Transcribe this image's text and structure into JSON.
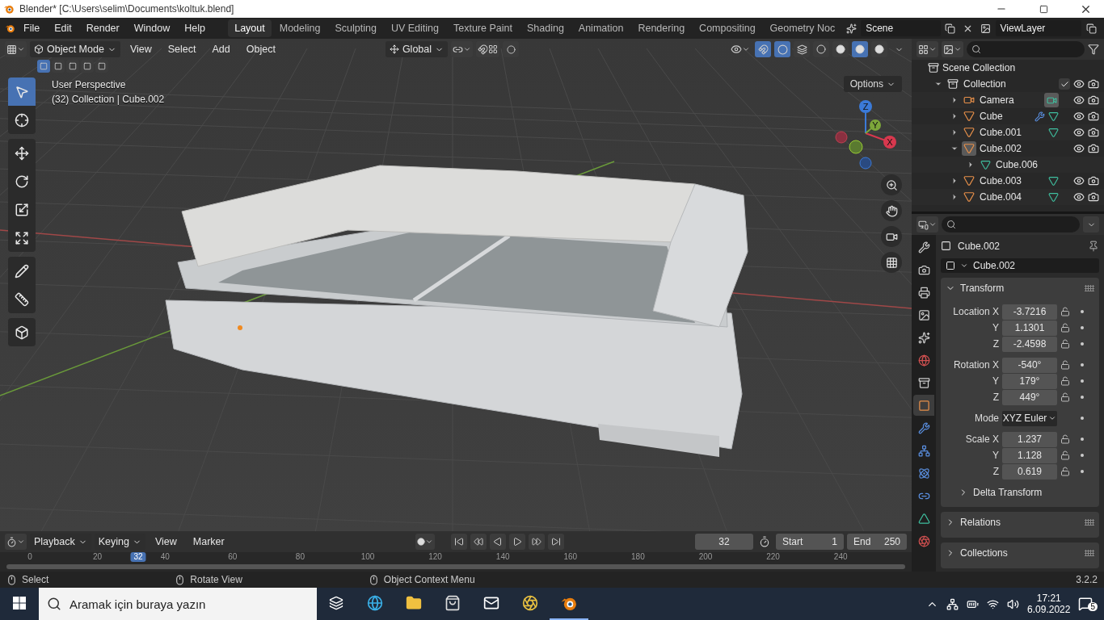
{
  "window": {
    "title": "Blender* [C:\\Users\\selim\\Documents\\koltuk.blend]"
  },
  "menu": [
    "File",
    "Edit",
    "Render",
    "Window",
    "Help"
  ],
  "workspaces": [
    {
      "label": "Layout",
      "selected": true
    },
    {
      "label": "Modeling",
      "selected": false
    },
    {
      "label": "Sculpting",
      "selected": false
    },
    {
      "label": "UV Editing",
      "selected": false
    },
    {
      "label": "Texture Paint",
      "selected": false
    },
    {
      "label": "Shading",
      "selected": false
    },
    {
      "label": "Animation",
      "selected": false
    },
    {
      "label": "Rendering",
      "selected": false
    },
    {
      "label": "Compositing",
      "selected": false
    },
    {
      "label": "Geometry Noc",
      "selected": false
    }
  ],
  "scene": "Scene",
  "view_layer": "ViewLayer",
  "viewport_header": {
    "mode": "Object Mode",
    "menus": [
      "View",
      "Select",
      "Add",
      "Object"
    ],
    "orientation": "Global",
    "options": "Options"
  },
  "viewport_toggles": [
    {
      "kind": "gizmo",
      "on": true
    },
    {
      "kind": "overlay",
      "on": true
    },
    {
      "kind": "xray",
      "on": false
    }
  ],
  "shading": [
    {
      "kind": "wireframe",
      "selected": false
    },
    {
      "kind": "solid",
      "selected": false
    },
    {
      "kind": "material",
      "selected": true
    },
    {
      "kind": "rendered",
      "selected": false
    }
  ],
  "select_modes": [
    {
      "selected": true
    },
    {
      "selected": false
    },
    {
      "selected": false
    },
    {
      "selected": false
    },
    {
      "selected": false
    }
  ],
  "toolbar": [
    {
      "kind": "select",
      "selected": true
    },
    {
      "kind": "cursor",
      "selected": false
    },
    {
      "kind": "move",
      "selected": false
    },
    {
      "kind": "rotate",
      "selected": false
    },
    {
      "kind": "scale",
      "selected": false
    },
    {
      "kind": "transform",
      "selected": false
    },
    {
      "kind": "annotate",
      "selected": false
    },
    {
      "kind": "measure",
      "selected": false
    },
    {
      "kind": "add-cube",
      "selected": false
    }
  ],
  "viewport_info": [
    "User Perspective",
    "(32) Collection | Cube.002"
  ],
  "gizmo": {
    "z": "Z",
    "y": "Y",
    "x": "X"
  },
  "outliner": {
    "root": "Scene Collection",
    "items": [
      {
        "name": "Collection",
        "kind": "collection",
        "expanded": true,
        "checked": true,
        "selected": false,
        "children": [
          {
            "name": "Camera",
            "kind": "camera",
            "expanded": false,
            "selected": false,
            "data_icons": [
              {
                "kind": "camera"
              }
            ]
          },
          {
            "name": "Cube",
            "kind": "object",
            "expanded": false,
            "selected": false,
            "data_icons": [
              {
                "kind": "wrench"
              },
              {
                "kind": "mesh"
              }
            ]
          },
          {
            "name": "Cube.001",
            "kind": "object",
            "expanded": false,
            "selected": false,
            "data_icons": [
              {
                "kind": "mesh"
              }
            ]
          },
          {
            "name": "Cube.002",
            "kind": "object",
            "expanded": true,
            "selected": true,
            "children": [
              {
                "name": "Cube.006",
                "kind": "mesh",
                "expanded": false,
                "selected": false
              }
            ]
          },
          {
            "name": "Cube.003",
            "kind": "object",
            "expanded": false,
            "selected": false,
            "data_icons": [
              {
                "kind": "mesh"
              }
            ]
          },
          {
            "name": "Cube.004",
            "kind": "object",
            "expanded": false,
            "selected": false,
            "data_icons": [
              {
                "kind": "mesh"
              }
            ]
          }
        ]
      }
    ]
  },
  "properties": {
    "tabs": [
      {
        "kind": "tool",
        "selected": false
      },
      {
        "kind": "render",
        "selected": false
      },
      {
        "kind": "output",
        "selected": false
      },
      {
        "kind": "view-layer",
        "selected": false
      },
      {
        "kind": "scene",
        "selected": false
      },
      {
        "kind": "world",
        "selected": false
      },
      {
        "kind": "collection",
        "selected": false
      },
      {
        "kind": "object",
        "selected": true
      },
      {
        "kind": "modifier",
        "selected": false
      },
      {
        "kind": "particles",
        "selected": false
      },
      {
        "kind": "physics",
        "selected": false
      },
      {
        "kind": "constraints",
        "selected": false
      },
      {
        "kind": "data",
        "selected": false
      },
      {
        "kind": "material",
        "selected": false
      }
    ],
    "object": "Cube.002",
    "name_field": "Cube.002",
    "panel": {
      "title": "Transform",
      "expanded": true,
      "groups": [
        {
          "rows": [
            {
              "label": "Location X",
              "value": "-3.7216",
              "kind": "number"
            },
            {
              "label": "Y",
              "value": "1.1301",
              "kind": "number"
            },
            {
              "label": "Z",
              "value": "-2.4598",
              "kind": "number"
            }
          ]
        },
        {
          "rows": [
            {
              "label": "Rotation X",
              "value": "-540°",
              "kind": "number"
            },
            {
              "label": "Y",
              "value": "179°",
              "kind": "number"
            },
            {
              "label": "Z",
              "value": "449°",
              "kind": "number"
            }
          ]
        },
        {
          "rows": [
            {
              "label": "Mode",
              "value": "XYZ Euler",
              "kind": "dropdown"
            }
          ]
        },
        {
          "rows": [
            {
              "label": "Scale X",
              "value": "1.237",
              "kind": "number"
            },
            {
              "label": "Y",
              "value": "1.128",
              "kind": "number"
            },
            {
              "label": "Z",
              "value": "0.619",
              "kind": "number"
            }
          ]
        }
      ],
      "subpanels": [
        {
          "title": "Delta Transform",
          "expanded": false
        }
      ]
    },
    "panels": [
      {
        "title": "Relations",
        "expanded": false
      },
      {
        "title": "Collections",
        "expanded": false
      }
    ]
  },
  "timeline": {
    "menus": [
      "Playback",
      "Keying",
      "View",
      "Marker"
    ],
    "current": "32",
    "start_label": "Start",
    "start": "1",
    "end_label": "End",
    "end": "250",
    "ruler": [
      "0",
      "20",
      "40",
      "60",
      "80",
      "100",
      "120",
      "140",
      "160",
      "180",
      "200",
      "220",
      "240"
    ],
    "playhead": "32"
  },
  "status_bar": {
    "hints": [
      "Select",
      "Rotate View",
      "Object Context Menu"
    ],
    "version": "3.2.2"
  },
  "taskbar": {
    "search": {
      "placeholder": "Aramak için buraya yazın"
    },
    "time": "17:21",
    "date": "6.09.2022",
    "notifications": "5"
  }
}
